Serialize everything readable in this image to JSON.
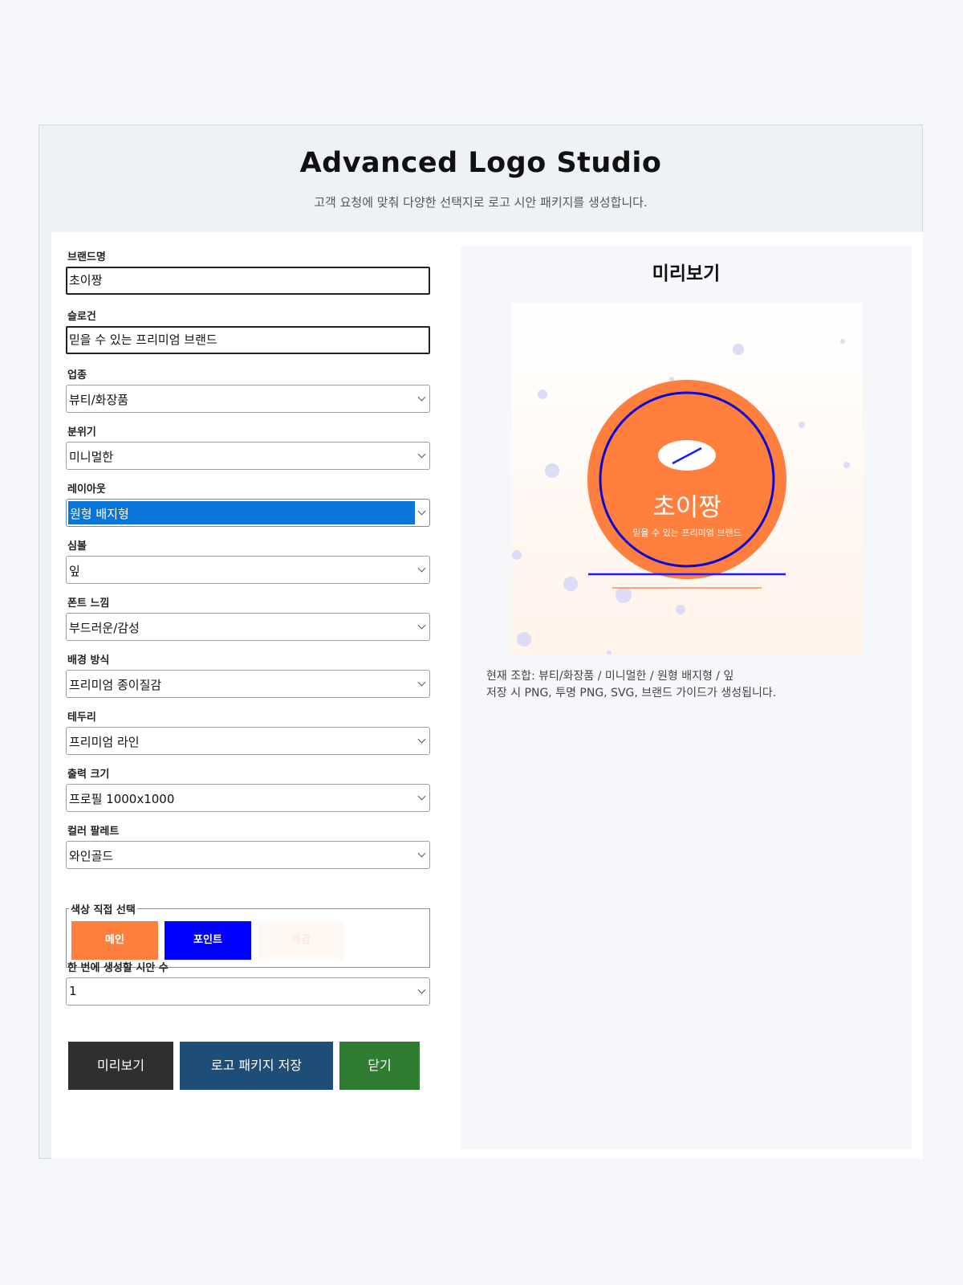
{
  "header": {
    "title": "Advanced Logo Studio",
    "subtitle": "고객 요청에 맞춰 다양한 선택지로 로고 시안 패키지를 생성합니다."
  },
  "form": {
    "brand": {
      "label": "브랜드명",
      "value": "초이짱"
    },
    "slogan": {
      "label": "슬로건",
      "value": "믿을 수 있는 프리미엄 브랜드"
    },
    "industry": {
      "label": "업종",
      "value": "뷰티/화장품"
    },
    "mood": {
      "label": "분위기",
      "value": "미니멀한"
    },
    "layout": {
      "label": "레이아웃",
      "value": "원형 배지형"
    },
    "symbol": {
      "label": "심볼",
      "value": "잎"
    },
    "font": {
      "label": "폰트 느낌",
      "value": "부드러운/감성"
    },
    "background": {
      "label": "배경 방식",
      "value": "프리미엄 종이질감"
    },
    "border": {
      "label": "테두리",
      "value": "프리미엄 라인"
    },
    "size": {
      "label": "출력 크기",
      "value": "프로필 1000x1000"
    },
    "palette": {
      "label": "컬러 팔레트",
      "value": "와인골드"
    },
    "colors": {
      "legend": "색상 직접 선택",
      "main": {
        "label": "메인",
        "color": "#ff7f3e"
      },
      "point": {
        "label": "포인트",
        "color": "#0000ff"
      },
      "bg": {
        "label": "배경",
        "color": "#fff7f2"
      }
    },
    "count": {
      "label": "한 번에 생성할 시안 수",
      "value": "1"
    }
  },
  "buttons": {
    "preview": "미리보기",
    "save": "로고 패키지 저장",
    "close": "닫기"
  },
  "preview": {
    "title": "미리보기",
    "logo_name": "초이짱",
    "logo_slogan": "믿을 수 있는 프리미엄 브랜드",
    "combo_line1": "현재 조합: 뷰티/화장품 / 미니멀한 / 원형 배지형 / 잎",
    "combo_line2": "저장 시 PNG, 투명 PNG, SVG, 브랜드 가이드가 생성됩니다."
  }
}
